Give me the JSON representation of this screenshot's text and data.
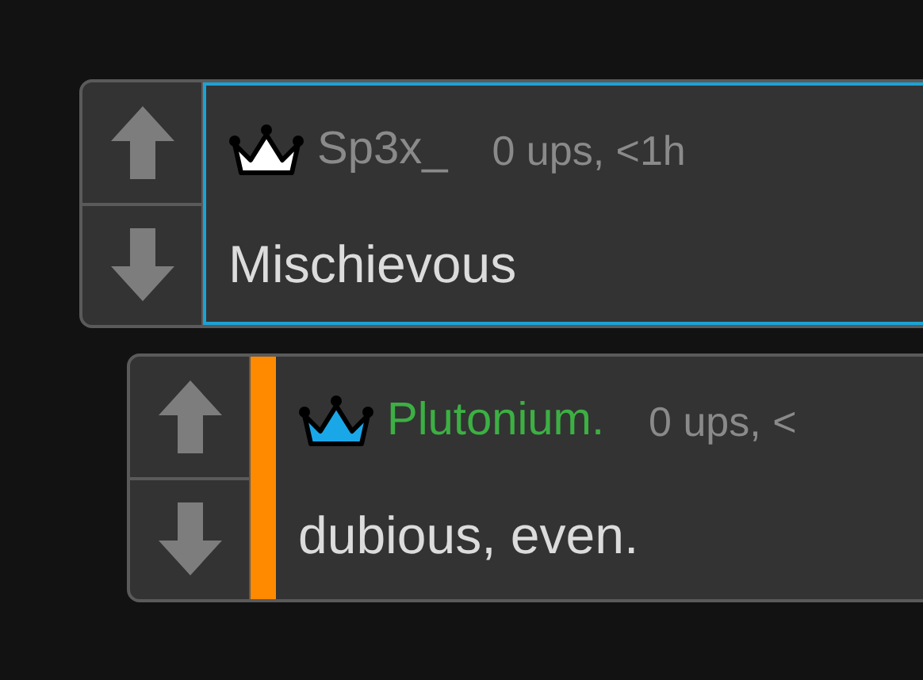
{
  "comments": [
    {
      "kind": "outlined",
      "crown": {
        "color": "#ffffff"
      },
      "author": {
        "name": "Sp3x_",
        "color": "#8a8a8a"
      },
      "meta": "0 ups, <1h",
      "body": "Mischievous"
    },
    {
      "kind": "bar",
      "bar": {
        "color": "#ff8a00"
      },
      "crown": {
        "color": "#1aa7e8"
      },
      "author": {
        "name": "Plutonium.",
        "color": "#3cb043"
      },
      "meta": "0 ups, <",
      "body": "dubious, even."
    }
  ]
}
